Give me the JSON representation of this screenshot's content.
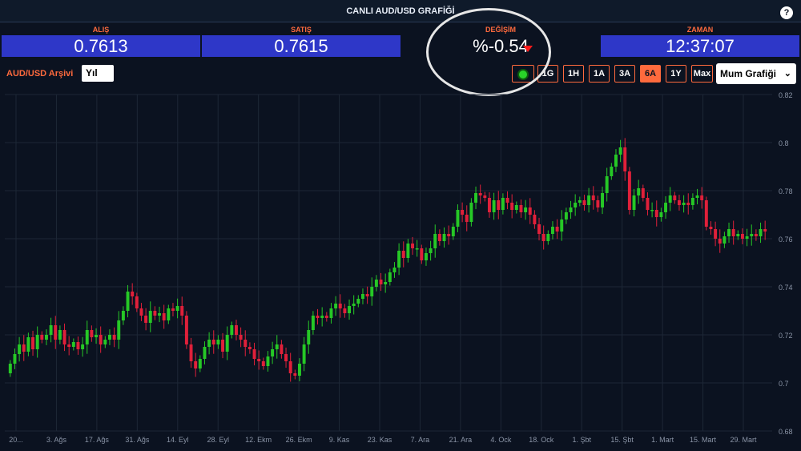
{
  "header": {
    "title": "CANLI AUD/USD GRAFİĞİ",
    "help": "?"
  },
  "quotes": {
    "bid": {
      "label": "ALIŞ",
      "value": "0.7613"
    },
    "ask": {
      "label": "SATIŞ",
      "value": "0.7615"
    },
    "change": {
      "label": "DEĞİŞİM",
      "value": "%-0.54"
    },
    "time": {
      "label": "ZAMAN",
      "value": "12:37:07"
    }
  },
  "toolbar": {
    "archive_label": "AUD/USD Arşivi",
    "period_value": "Yıl",
    "ranges": [
      "1G",
      "1H",
      "1A",
      "3A",
      "6A",
      "1Y",
      "Max"
    ],
    "active_range": "6A",
    "chart_type": "Mum Grafiği"
  },
  "colors": {
    "up": "#26c826",
    "down": "#e0203a",
    "accent": "#ff6a3d",
    "quote_bg": "#2e37c8"
  },
  "chart_data": {
    "type": "candlestick",
    "xlabels": [
      "20...",
      "3. Ağs",
      "17. Ağs",
      "31. Ağs",
      "14. Eyl",
      "28. Eyl",
      "12. Ekm",
      "26. Ekm",
      "9. Kas",
      "23. Kas",
      "7. Ara",
      "21. Ara",
      "4. Ock",
      "18. Ock",
      "1. Şbt",
      "15. Şbt",
      "1. Mart",
      "15. Mart",
      "29. Mart"
    ],
    "ylabels": [
      "0.82",
      "0.8",
      "0.78",
      "0.76",
      "0.74",
      "0.72",
      "0.7",
      "0.68"
    ],
    "ylim": [
      0.68,
      0.82
    ],
    "grid": true,
    "close": [
      0.708,
      0.712,
      0.716,
      0.713,
      0.719,
      0.714,
      0.72,
      0.718,
      0.72,
      0.724,
      0.718,
      0.722,
      0.716,
      0.715,
      0.717,
      0.714,
      0.716,
      0.722,
      0.719,
      0.72,
      0.716,
      0.718,
      0.72,
      0.718,
      0.726,
      0.73,
      0.738,
      0.736,
      0.731,
      0.728,
      0.725,
      0.73,
      0.728,
      0.729,
      0.726,
      0.731,
      0.73,
      0.732,
      0.728,
      0.716,
      0.709,
      0.706,
      0.71,
      0.715,
      0.718,
      0.716,
      0.718,
      0.713,
      0.72,
      0.724,
      0.72,
      0.718,
      0.715,
      0.714,
      0.71,
      0.709,
      0.707,
      0.711,
      0.714,
      0.716,
      0.712,
      0.709,
      0.704,
      0.703,
      0.708,
      0.716,
      0.722,
      0.728,
      0.727,
      0.728,
      0.727,
      0.731,
      0.733,
      0.731,
      0.729,
      0.732,
      0.733,
      0.735,
      0.737,
      0.736,
      0.74,
      0.743,
      0.741,
      0.742,
      0.746,
      0.748,
      0.755,
      0.752,
      0.758,
      0.756,
      0.756,
      0.751,
      0.754,
      0.756,
      0.762,
      0.759,
      0.762,
      0.761,
      0.765,
      0.772,
      0.77,
      0.767,
      0.775,
      0.779,
      0.778,
      0.777,
      0.771,
      0.776,
      0.772,
      0.777,
      0.775,
      0.772,
      0.774,
      0.771,
      0.773,
      0.77,
      0.766,
      0.762,
      0.759,
      0.762,
      0.765,
      0.763,
      0.768,
      0.771,
      0.773,
      0.775,
      0.776,
      0.774,
      0.778,
      0.776,
      0.773,
      0.779,
      0.786,
      0.79,
      0.795,
      0.798,
      0.788,
      0.772,
      0.778,
      0.781,
      0.777,
      0.772,
      0.772,
      0.769,
      0.771,
      0.775,
      0.778,
      0.776,
      0.774,
      0.775,
      0.774,
      0.777,
      0.778,
      0.776,
      0.765,
      0.764,
      0.76,
      0.758,
      0.761,
      0.764,
      0.761,
      0.762,
      0.76,
      0.761,
      0.762,
      0.761,
      0.764,
      0.763
    ]
  }
}
